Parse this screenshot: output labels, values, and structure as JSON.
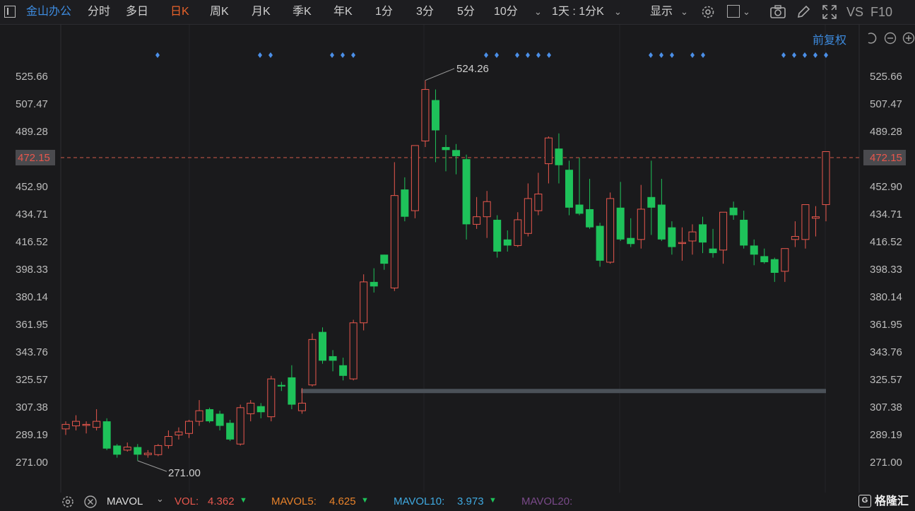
{
  "toolbar": {
    "stock_name": "金山办公",
    "tabs": [
      {
        "label": "分时",
        "active": false
      },
      {
        "label": "多日",
        "active": false
      },
      {
        "label": "日K",
        "active": true
      },
      {
        "label": "周K",
        "active": false
      },
      {
        "label": "月K",
        "active": false
      },
      {
        "label": "季K",
        "active": false
      },
      {
        "label": "年K",
        "active": false
      },
      {
        "label": "1分",
        "active": false
      },
      {
        "label": "3分",
        "active": false
      },
      {
        "label": "5分",
        "active": false
      },
      {
        "label": "10分",
        "active": false
      }
    ],
    "period_select": "1天 : 1分K",
    "display_label": "显示",
    "vs_label": "VS",
    "f10_label": "F10",
    "icons": [
      "panel-toggle-icon",
      "chevron-down-icon",
      "gear-icon",
      "square-icon",
      "camera-icon",
      "pencil-icon",
      "fullscreen-icon"
    ]
  },
  "adjust_label": "前复权",
  "chart_data": {
    "type": "candlestick",
    "price_axis_ticks": [
      "525.66",
      "507.47",
      "489.28",
      "472.15",
      "452.90",
      "434.71",
      "416.52",
      "398.33",
      "380.14",
      "361.95",
      "343.76",
      "325.57",
      "307.38",
      "289.19",
      "271.00"
    ],
    "current_price": "472.15",
    "high_annotation": "524.26",
    "low_annotation": "271.00",
    "support_line": 318,
    "candles": [
      [
        293,
        296,
        289,
        298
      ],
      [
        295,
        298,
        292,
        302
      ],
      [
        296,
        296,
        290,
        298
      ],
      [
        294,
        298,
        292,
        306
      ],
      [
        298,
        280,
        279,
        300
      ],
      [
        282,
        276,
        274,
        283
      ],
      [
        279,
        281,
        278,
        284
      ],
      [
        281,
        276,
        272,
        283
      ],
      [
        276,
        277,
        274,
        279
      ],
      [
        276,
        282,
        275,
        283
      ],
      [
        282,
        288,
        280,
        292
      ],
      [
        289,
        291,
        286,
        294
      ],
      [
        290,
        298,
        287,
        299
      ],
      [
        298,
        305,
        295,
        312
      ],
      [
        306,
        298,
        297,
        307
      ],
      [
        303,
        295,
        292,
        305
      ],
      [
        297,
        286,
        285,
        299
      ],
      [
        283,
        307,
        282,
        309
      ],
      [
        303,
        310,
        298,
        312
      ],
      [
        308,
        304,
        300,
        310
      ],
      [
        301,
        326,
        298,
        328
      ],
      [
        322,
        321,
        318,
        324
      ],
      [
        327,
        309,
        306,
        335
      ],
      [
        305,
        310,
        303,
        320
      ],
      [
        322,
        352,
        321,
        356
      ],
      [
        357,
        338,
        336,
        360
      ],
      [
        341,
        338,
        331,
        345
      ],
      [
        335,
        328,
        325,
        340
      ],
      [
        326,
        363,
        325,
        365
      ],
      [
        363,
        390,
        358,
        395
      ],
      [
        390,
        387,
        383,
        399
      ],
      [
        408,
        402,
        398,
        408
      ],
      [
        386,
        447,
        384,
        469
      ],
      [
        451,
        433,
        430,
        459
      ],
      [
        437,
        480,
        432,
        480
      ],
      [
        483,
        517,
        479,
        523
      ],
      [
        510,
        490,
        469,
        517
      ],
      [
        479,
        477,
        463,
        487
      ],
      [
        477,
        473,
        461,
        481
      ],
      [
        471,
        428,
        418,
        474
      ],
      [
        428,
        433,
        425,
        446
      ],
      [
        433,
        443,
        419,
        450
      ],
      [
        431,
        410,
        406,
        434
      ],
      [
        418,
        414,
        410,
        424
      ],
      [
        414,
        431,
        413,
        436
      ],
      [
        422,
        445,
        420,
        455
      ],
      [
        437,
        448,
        434,
        462
      ],
      [
        468,
        485,
        455,
        486
      ],
      [
        478,
        467,
        455,
        488
      ],
      [
        464,
        439,
        434,
        470
      ],
      [
        441,
        435,
        434,
        472
      ],
      [
        438,
        426,
        425,
        458
      ],
      [
        427,
        404,
        400,
        429
      ],
      [
        403,
        445,
        402,
        449
      ],
      [
        439,
        418,
        417,
        456
      ],
      [
        419,
        415,
        413,
        432
      ],
      [
        418,
        438,
        412,
        454
      ],
      [
        446,
        439,
        421,
        470
      ],
      [
        441,
        418,
        417,
        458
      ],
      [
        426,
        413,
        408,
        430
      ],
      [
        416,
        416,
        404,
        426
      ],
      [
        417,
        423,
        408,
        428
      ],
      [
        428,
        416,
        409,
        433
      ],
      [
        412,
        409,
        406,
        425
      ],
      [
        411,
        436,
        402,
        436
      ],
      [
        439,
        434,
        431,
        443
      ],
      [
        431,
        414,
        412,
        437
      ],
      [
        414,
        408,
        401,
        418
      ],
      [
        407,
        403,
        402,
        412
      ],
      [
        405,
        396,
        390,
        406
      ],
      [
        397,
        412,
        390,
        412
      ],
      [
        418,
        420,
        413,
        430
      ],
      [
        418,
        441,
        412,
        441
      ],
      [
        432,
        433,
        420,
        440
      ],
      [
        441,
        476,
        430,
        476
      ]
    ]
  },
  "bottom_bar": {
    "indicator": "MAVOL",
    "vol_label": "VOL:",
    "vol_value": "4.362",
    "mavol5_label": "MAVOL5:",
    "mavol5_value": "4.625",
    "mavol10_label": "MAVOL10:",
    "mavol10_value": "3.973",
    "mavol20_label": "MAVOL20:",
    "brand": "格隆汇"
  },
  "colors": {
    "up": "#e8574d",
    "down": "#1ec25a",
    "accent": "#e8622a",
    "link": "#3d8bdf",
    "marker": "#4b8fe8"
  }
}
